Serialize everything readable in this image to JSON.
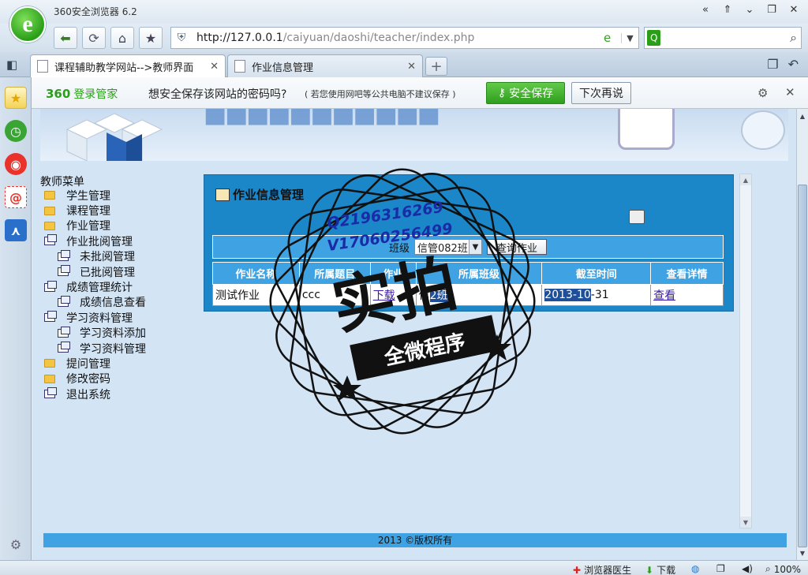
{
  "browser": {
    "app_title": "360安全浏览器 6.2",
    "logo_letter": "e",
    "window_controls": [
      "«",
      "⇑",
      "⌄",
      "❐",
      "✕"
    ],
    "url_host": "http://127.0.0.1",
    "url_path": "/caiyuan/daoshi/teacher/index.php",
    "search_placeholder": ""
  },
  "tabs": [
    {
      "label": "课程辅助教学网站-->教师界面",
      "close": "✕"
    },
    {
      "label": "作业信息管理",
      "close": "✕"
    }
  ],
  "new_tab": "+",
  "password_bar": {
    "brand": "360",
    "brand_suffix": "登录管家",
    "message": "想安全保存该网站的密码吗?",
    "tip": "( 若您使用网吧等公共电脑不建议保存 )",
    "save_button": "安全保存",
    "later_button": "下次再说"
  },
  "menu": {
    "title": "教师菜单",
    "items": [
      {
        "label": "学生管理",
        "level": 0,
        "icon": "folder-closed"
      },
      {
        "label": "课程管理",
        "level": 0,
        "icon": "folder-closed"
      },
      {
        "label": "作业管理",
        "level": 0,
        "icon": "folder-closed"
      },
      {
        "label": "作业批阅管理",
        "level": 0,
        "icon": "folder-open"
      },
      {
        "label": "未批阅管理",
        "level": 1,
        "icon": "folder-open"
      },
      {
        "label": "已批阅管理",
        "level": 1,
        "icon": "folder-open"
      },
      {
        "label": "成绩管理统计",
        "level": 0,
        "icon": "folder-open"
      },
      {
        "label": "成绩信息查看",
        "level": 1,
        "icon": "folder-open"
      },
      {
        "label": "学习资料管理",
        "level": 0,
        "icon": "folder-open"
      },
      {
        "label": "学习资料添加",
        "level": 1,
        "icon": "folder-open"
      },
      {
        "label": "学习资料管理",
        "level": 1,
        "icon": "folder-open"
      },
      {
        "label": "提问管理",
        "level": 0,
        "icon": "folder-closed"
      },
      {
        "label": "修改密码",
        "level": 0,
        "icon": "folder-closed"
      },
      {
        "label": "退出系统",
        "level": 0,
        "icon": "folder-open"
      }
    ]
  },
  "panel": {
    "title": "作业信息管理",
    "filter_label": "班级",
    "filter_value": "信管082班",
    "query_button": "查询作业",
    "columns": [
      "作业名称",
      "所属题目",
      "作业",
      "所属班级",
      "截至时间",
      "查看详情"
    ],
    "rows": [
      {
        "name": "测试作业",
        "topic": "ccc",
        "file": "下载",
        "class_prefix": "信",
        "class_suffix": "2班",
        "deadline": "2013-10-31",
        "deadline_hl": "2013-10",
        "deadline_rest": "-31",
        "detail": "查看"
      }
    ]
  },
  "footer": "2013 ©版权所有",
  "status": {
    "doctor": "浏览器医生",
    "download": "下载",
    "zoom": "100%"
  },
  "watermark": {
    "line1": "Q2196316269",
    "line2": "V17060256499",
    "big": "实拍",
    "ribbon": "全微程序"
  }
}
